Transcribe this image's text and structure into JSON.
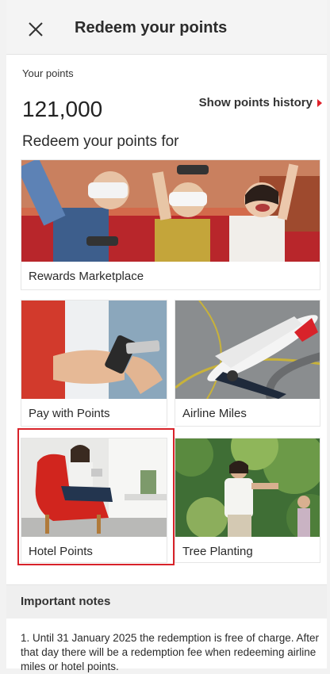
{
  "header": {
    "title": "Redeem your points",
    "close_icon": "close-icon"
  },
  "points": {
    "label": "Your points",
    "value": "121,000",
    "history_link": "Show points history"
  },
  "redeem_heading": "Redeem your points for",
  "options": {
    "rewards_marketplace": "Rewards Marketplace",
    "pay_with_points": "Pay with Points",
    "airline_miles": "Airline Miles",
    "hotel_points": "Hotel Points",
    "tree_planting": "Tree Planting"
  },
  "notes": {
    "title": "Important notes",
    "text": "1. Until 31 January 2025 the redemption is free of charge. After that day there will be a redemption fee when redeeming airline miles or hotel points."
  },
  "colors": {
    "accent": "#d8232a",
    "background": "#f2f2f2"
  }
}
